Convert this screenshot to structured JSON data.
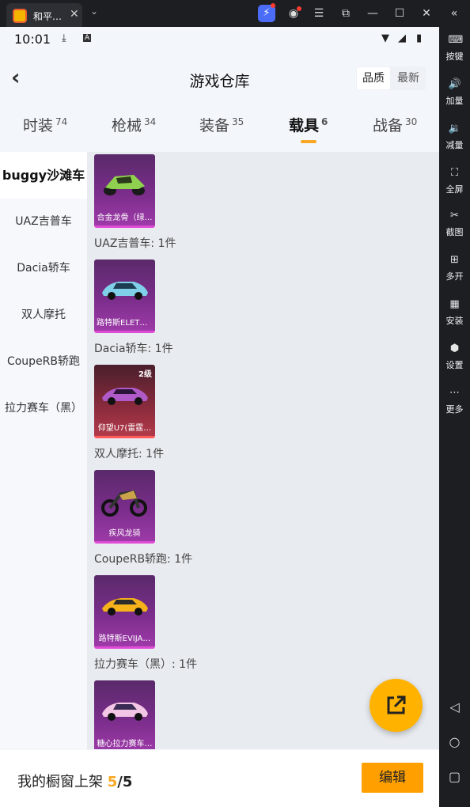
{
  "emulator": {
    "tab_title": "和平…",
    "tab_close": "✕",
    "tab_dropdown": "⌄",
    "sidebar": [
      {
        "label": "按键",
        "icon": "keyboard-icon"
      },
      {
        "label": "加量",
        "icon": "volume-up-icon"
      },
      {
        "label": "减量",
        "icon": "volume-down-icon"
      },
      {
        "label": "全屏",
        "icon": "fullscreen-icon"
      },
      {
        "label": "截图",
        "icon": "scissors-icon"
      },
      {
        "label": "多开",
        "icon": "multi-instance-icon"
      },
      {
        "label": "安装",
        "icon": "apk-install-icon"
      },
      {
        "label": "设置",
        "icon": "settings-icon"
      },
      {
        "label": "更多",
        "icon": "more-icon"
      }
    ],
    "nav_icons": [
      "back-triangle-icon",
      "home-circle-icon",
      "recents-square-icon"
    ]
  },
  "status_bar": {
    "time": "10:01"
  },
  "header": {
    "title": "游戏仓库",
    "sort_options": [
      "品质",
      "最新"
    ],
    "active_sort": "品质"
  },
  "categories": [
    {
      "label": "时装",
      "count": "74"
    },
    {
      "label": "枪械",
      "count": "34"
    },
    {
      "label": "装备",
      "count": "35"
    },
    {
      "label": "载具",
      "count": "6",
      "active": true
    },
    {
      "label": "战备",
      "count": "30"
    }
  ],
  "left_nav": [
    {
      "label": "buggy沙滩车",
      "active": true
    },
    {
      "label": "UAZ吉普车"
    },
    {
      "label": "Dacia轿车"
    },
    {
      "label": "双人摩托"
    },
    {
      "label": "CoupeRB轿跑"
    },
    {
      "label": "拉力赛车（黑）"
    }
  ],
  "groups": [
    {
      "title": "",
      "item": {
        "name": "合金龙骨（绿…",
        "level": ""
      }
    },
    {
      "title": "UAZ吉普车: 1件",
      "item": {
        "name": "路特斯ELETR…",
        "level": ""
      }
    },
    {
      "title": "Dacia轿车: 1件",
      "item": {
        "name": "仰望U7(雷霆…",
        "level": "2级"
      }
    },
    {
      "title": "双人摩托: 1件",
      "item": {
        "name": "疾风龙骑",
        "level": ""
      }
    },
    {
      "title": "CoupeRB轿跑: 1件",
      "item": {
        "name": "路特斯EVIJA…",
        "level": ""
      }
    },
    {
      "title": "拉力赛车（黑）: 1件",
      "item": {
        "name": "糖心拉力赛车…",
        "level": ""
      }
    }
  ],
  "bottom_bar": {
    "label": "我的橱窗上架",
    "count": "5",
    "total": "/5",
    "edit_label": "编辑"
  },
  "colors": {
    "accent": "#f9a825",
    "edit_button": "#ffa000",
    "fab": "#ffb300"
  }
}
